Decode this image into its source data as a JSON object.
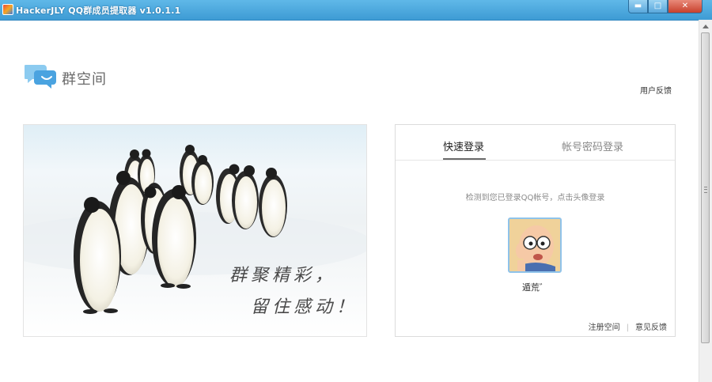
{
  "window": {
    "title": "HackerJLY QQ群成员提取器 v1.0.1.1",
    "min_glyph": "▬",
    "max_glyph": "□",
    "close_glyph": "✕"
  },
  "header": {
    "logo_text": "群空间",
    "feedback_link": "用户反馈",
    "logo_color": "#5aaee8"
  },
  "hero": {
    "caption_line1": "群聚精彩，",
    "caption_line2": "留住感动！"
  },
  "login": {
    "tabs": [
      {
        "label": "快速登录",
        "active": true
      },
      {
        "label": "帐号密码登录",
        "active": false
      }
    ],
    "hint": "检测到您已登录QQ帐号，点击头像登录",
    "user": {
      "nickname": "遁荒゛",
      "avatar_icon": "cartoon-face-avatar"
    },
    "links": {
      "register": "注册空间",
      "feedback": "意见反馈"
    }
  },
  "colors": {
    "titlebar": "#4aa8de",
    "accent": "#8fc3ea"
  }
}
